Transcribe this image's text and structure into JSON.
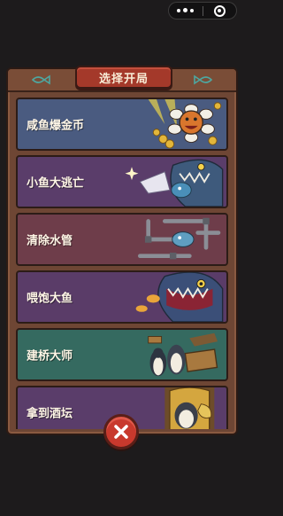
{
  "title": "选择开局",
  "colors": {
    "frame": "#6e4634",
    "title_badge": "#a4392a",
    "close_button": "#c8392d"
  },
  "items": [
    {
      "label": "咸鱼爆金币",
      "bg": "#4a5b80",
      "icon": "sunflower-coins-art"
    },
    {
      "label": "小鱼大逃亡",
      "bg": "#5a3d6a",
      "icon": "shark-fish-escape-art"
    },
    {
      "label": "清除水管",
      "bg": "#6e3d4a",
      "icon": "pipes-fish-art"
    },
    {
      "label": "喂饱大鱼",
      "bg": "#5a3c68",
      "icon": "big-fish-feeding-art"
    },
    {
      "label": "建桥大师",
      "bg": "#356a60",
      "icon": "penguin-bridge-art"
    },
    {
      "label": "拿到酒坛",
      "bg": "#5a3d6a",
      "icon": "wine-jar-art"
    }
  ],
  "close_icon": "close-x-icon"
}
